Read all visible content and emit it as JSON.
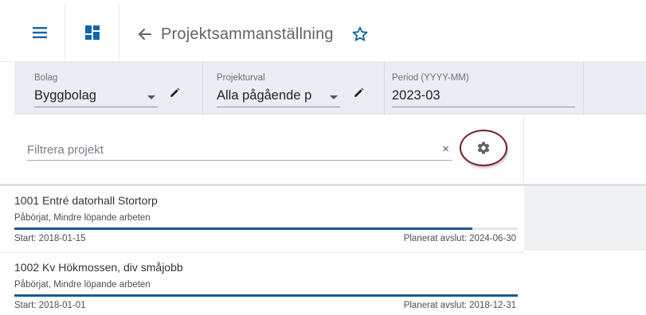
{
  "header": {
    "title": "Projektsammanställning",
    "icons": [
      "menu-icon",
      "dashboard-icon",
      "back-arrow-icon",
      "star-icon"
    ]
  },
  "filters": {
    "company": {
      "label": "Bolag",
      "value": "Byggbolag"
    },
    "project_selection": {
      "label": "Projekturval",
      "value": "Alla pågående p"
    },
    "period": {
      "label": "Period (YYYY-MM)",
      "value": "2023-03"
    }
  },
  "search": {
    "placeholder": "Filtrera projekt",
    "clear": "×"
  },
  "projects": [
    {
      "title": "1001 Entré datorhall Stortorp",
      "status": "Påbörjat, Mindre löpande arbeten",
      "progress": 0.91,
      "start": "Start: 2018-01-15",
      "end": "Planerat avslut: 2024-06-30"
    },
    {
      "title": "1002 Kv Hökmossen, div småjobb",
      "status": "Påbörjat, Mindre löpande arbeten",
      "progress": 1.0,
      "start": "Start: 2018-01-01",
      "end": "Planerat avslut: 2018-12-31"
    }
  ],
  "colors": {
    "accent": "#1565a6",
    "progress": "#155b8f",
    "filter_bg": "#eaeef4",
    "highlight_ring": "#7a1f2b"
  }
}
